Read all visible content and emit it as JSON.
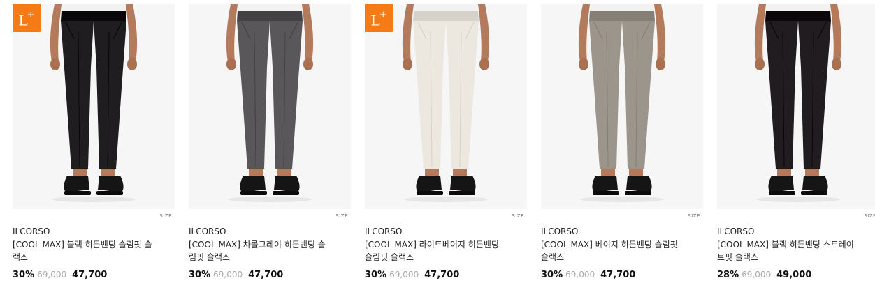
{
  "badge_text": "L",
  "badge_sup": "+",
  "size_label": "SIZE",
  "products": [
    {
      "brand": "ILCORSO",
      "name": "[COOL MAX] 블랙 히든밴딩 슬림핏 슬랙스",
      "discount": "30%",
      "original_price": "69,000",
      "sale_price": "47,700",
      "lplus": true,
      "pants_color": "#1f1d1f"
    },
    {
      "brand": "ILCORSO",
      "name": "[COOL MAX] 차콜그레이 히든밴딩 슬림핏 슬랙스",
      "discount": "30%",
      "original_price": "69,000",
      "sale_price": "47,700",
      "lplus": false,
      "pants_color": "#59575a"
    },
    {
      "brand": "ILCORSO",
      "name": "[COOL MAX] 라이트베이지 히든밴딩 슬림핏 슬랙스",
      "discount": "30%",
      "original_price": "69,000",
      "sale_price": "47,700",
      "lplus": true,
      "pants_color": "#ece8e0"
    },
    {
      "brand": "ILCORSO",
      "name": "[COOL MAX] 베이지 히든밴딩 슬림핏 슬랙스",
      "discount": "30%",
      "original_price": "69,000",
      "sale_price": "47,700",
      "lplus": false,
      "pants_color": "#9b958b"
    },
    {
      "brand": "ILCORSO",
      "name": "[COOL MAX] 블랙 히든밴딩 스트레이트핏 슬랙스",
      "discount": "28%",
      "original_price": "69,000",
      "sale_price": "49,000",
      "lplus": false,
      "pants_color": "#211c1f"
    }
  ]
}
